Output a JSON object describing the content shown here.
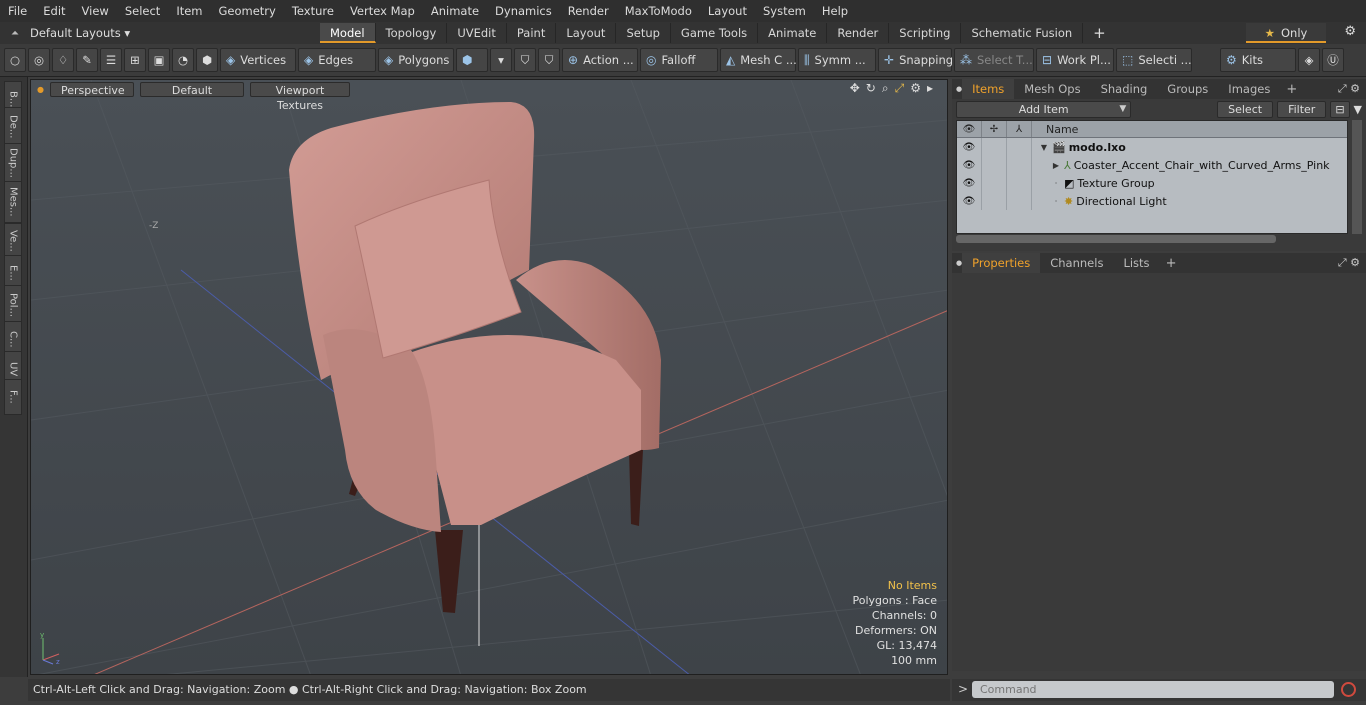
{
  "menu": [
    "File",
    "Edit",
    "View",
    "Select",
    "Item",
    "Geometry",
    "Texture",
    "Vertex Map",
    "Animate",
    "Dynamics",
    "Render",
    "MaxToModo",
    "Layout",
    "System",
    "Help"
  ],
  "layout_selector": "Default Layouts ▾",
  "tabs": [
    {
      "label": "Model",
      "active": true
    },
    {
      "label": "Topology"
    },
    {
      "label": "UVEdit"
    },
    {
      "label": "Paint"
    },
    {
      "label": "Layout"
    },
    {
      "label": "Setup"
    },
    {
      "label": "Game Tools"
    },
    {
      "label": "Animate"
    },
    {
      "label": "Render"
    },
    {
      "label": "Scripting"
    },
    {
      "label": "Schematic Fusion"
    }
  ],
  "tab_plus": "+",
  "only_label": "Only",
  "toolbar": {
    "vertices": "Vertices",
    "edges": "Edges",
    "polygons": "Polygons",
    "action": "Action ...",
    "falloff": "Falloff",
    "mesh": "Mesh C ...",
    "symm": "Symm ...",
    "snapping": "Snapping",
    "select_t": "Select T...",
    "work_pl": "Work Pl...",
    "selecti": "Selecti ...",
    "kits": "Kits"
  },
  "left_tabs": [
    "B...",
    "De...",
    "Dup...",
    "Mes...",
    "Ve...",
    "E...",
    "Pol...",
    "C...",
    "UV",
    "F..."
  ],
  "viewport": {
    "perspective": "Perspective",
    "default": "Default",
    "textures": "Viewport Textures",
    "minus_z": "-Z",
    "info": {
      "no_items": "No Items",
      "polygons": "Polygons : Face",
      "channels": "Channels: 0",
      "deformers": "Deformers: ON",
      "gl": "GL: 13,474",
      "scale": "100 mm"
    }
  },
  "status": "Ctrl-Alt-Left Click and Drag: Navigation: Zoom ● Ctrl-Alt-Right Click and Drag: Navigation: Box Zoom",
  "items_panel": {
    "tabs": [
      {
        "label": "Items",
        "active": true
      },
      {
        "label": "Mesh Ops"
      },
      {
        "label": "Shading"
      },
      {
        "label": "Groups"
      },
      {
        "label": "Images"
      }
    ],
    "add_item": "Add Item",
    "select": "Select",
    "filter": "Filter",
    "name_col": "Name",
    "rows": [
      {
        "label": "modo.lxo",
        "bold": true
      },
      {
        "label": "Coaster_Accent_Chair_with_Curved_Arms_Pink"
      },
      {
        "label": "Texture Group"
      },
      {
        "label": "Directional Light"
      }
    ]
  },
  "props_panel": {
    "tabs": [
      {
        "label": "Properties",
        "active": true
      },
      {
        "label": "Channels"
      },
      {
        "label": "Lists"
      }
    ]
  },
  "command": {
    "placeholder": "Command"
  },
  "colors": {
    "accent": "#e39a2a",
    "chair": "#c48a82",
    "legs": "#3b1e1a"
  }
}
